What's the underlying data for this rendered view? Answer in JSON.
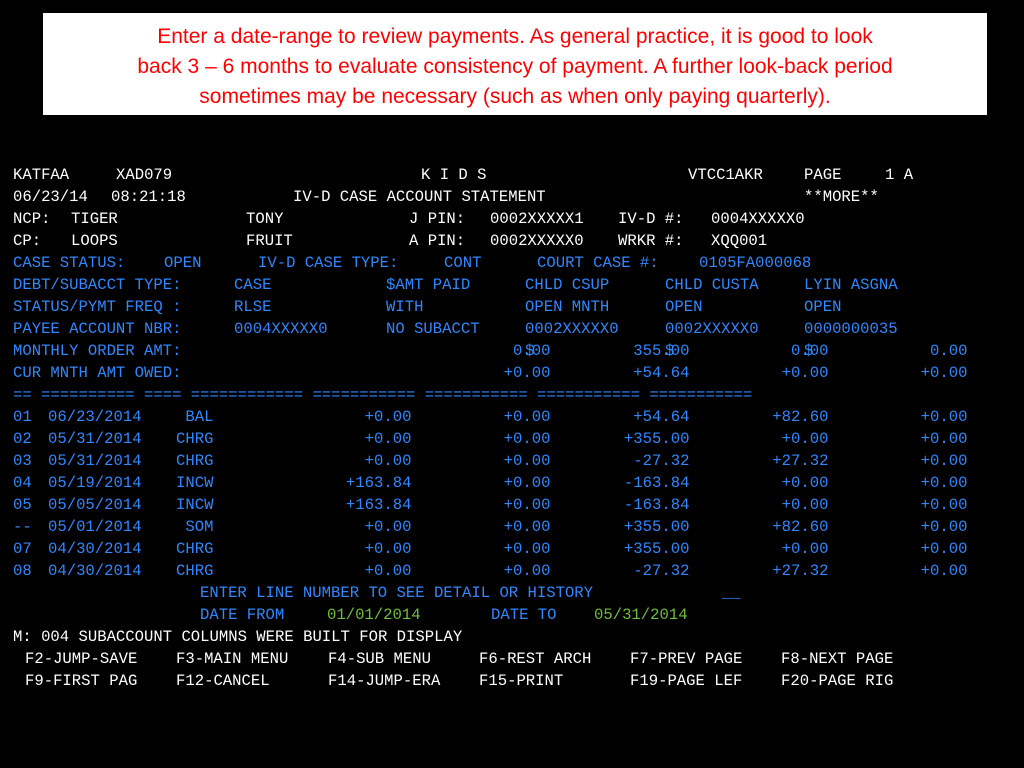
{
  "callout": {
    "lines": [
      "Enter a date-range to review payments.  As general practice, it is good to look",
      "back 3 – 6 months to evaluate consistency of payment. A further look-back period",
      "sometimes may be necessary (such as when only paying quarterly)."
    ]
  },
  "header": {
    "user": "KATFAA",
    "program": "XAD079",
    "system": "K I D S",
    "terminal": "VTCC1AKR",
    "page_label": "PAGE",
    "page_number": "1 A",
    "date": "06/23/14",
    "time": "08:21:18",
    "screen_title": "IV-D CASE ACCOUNT STATEMENT",
    "more": "**MORE**"
  },
  "ncp": {
    "label": "NCP:",
    "last": "TIGER",
    "first": "TONY",
    "pin_label": "J PIN:",
    "pin": "0002XXXXX1",
    "ivd_label": "IV-D #:",
    "ivd": "0004XXXXX0"
  },
  "cp": {
    "label": "CP:",
    "last": "LOOPS",
    "first": "FRUIT",
    "pin_label": "A PIN:",
    "pin": "0002XXXXX0",
    "wrkr_label": "WRKR #:",
    "wrkr": "XQQ001"
  },
  "case_status": {
    "status_label": "CASE STATUS:",
    "status": "OPEN",
    "type_label": "IV-D CASE TYPE:",
    "type": "CONT",
    "court_label": "COURT CASE #:",
    "court": "0105FA000068"
  },
  "table": {
    "debt_label": "DEBT/SUBACCT TYPE:",
    "debt_types": [
      "CASE",
      "$AMT PAID",
      "CHLD CSUP",
      "CHLD CUSTA",
      "LYIN ASGNA"
    ],
    "status_label": "STATUS/PYMT FREQ :",
    "statuses": [
      "RLSE",
      "WITH",
      "OPEN MNTH",
      "OPEN",
      "OPEN"
    ],
    "payee_label": "PAYEE ACCOUNT NBR:",
    "payees": [
      "0004XXXXX0",
      "NO SUBACCT",
      "0002XXXXX0",
      "0002XXXXX0",
      "0000000035"
    ],
    "monthly_label": "MONTHLY ORDER AMT:",
    "monthly": [
      "0.00",
      "$",
      "355.00",
      "$",
      "0.00",
      "$",
      "0.00"
    ],
    "cur_label": "CUR MNTH AMT OWED:",
    "cur": [
      "+0.00",
      "+54.64",
      "+0.00",
      "+0.00"
    ],
    "divider": "== ========== ==== ============ =========== =========== =========== ===========",
    "rows": [
      {
        "line": "01",
        "date": "06/23/2014",
        "code": " BAL",
        "v1": "+0.00",
        "v2": "+0.00",
        "v3": "+54.64",
        "v4": "+82.60",
        "v5": "+0.00"
      },
      {
        "line": "02",
        "date": "05/31/2014",
        "code": "CHRG",
        "v1": "+0.00",
        "v2": "+0.00",
        "v3": "+355.00",
        "v4": "+0.00",
        "v5": "+0.00"
      },
      {
        "line": "03",
        "date": "05/31/2014",
        "code": "CHRG",
        "v1": "+0.00",
        "v2": "+0.00",
        "v3": "-27.32",
        "v4": "+27.32",
        "v5": "+0.00"
      },
      {
        "line": "04",
        "date": "05/19/2014",
        "code": "INCW",
        "v1": "+163.84",
        "v2": "+0.00",
        "v3": "-163.84",
        "v4": "+0.00",
        "v5": "+0.00"
      },
      {
        "line": "05",
        "date": "05/05/2014",
        "code": "INCW",
        "v1": "+163.84",
        "v2": "+0.00",
        "v3": "-163.84",
        "v4": "+0.00",
        "v5": "+0.00"
      },
      {
        "line": "--",
        "date": "05/01/2014",
        "code": " SOM",
        "v1": "+0.00",
        "v2": "+0.00",
        "v3": "+355.00",
        "v4": "+82.60",
        "v5": "+0.00"
      },
      {
        "line": "07",
        "date": "04/30/2014",
        "code": "CHRG",
        "v1": "+0.00",
        "v2": "+0.00",
        "v3": "+355.00",
        "v4": "+0.00",
        "v5": "+0.00"
      },
      {
        "line": "08",
        "date": "04/30/2014",
        "code": "CHRG",
        "v1": "+0.00",
        "v2": "+0.00",
        "v3": "-27.32",
        "v4": "+27.32",
        "v5": "+0.00"
      }
    ]
  },
  "prompt": {
    "enter_line": "ENTER LINE NUMBER TO SEE DETAIL OR HISTORY",
    "line_input": "__",
    "date_from_label": "DATE FROM",
    "date_from": "01/01/2014",
    "date_to_label": "DATE TO",
    "date_to": "05/31/2014"
  },
  "message": "M: 004 SUBACCOUNT COLUMNS WERE BUILT FOR DISPLAY",
  "fkeys": {
    "row1": [
      {
        "key": "F2",
        "label": "JUMP-SAVE"
      },
      {
        "key": "F3",
        "label": "MAIN MENU"
      },
      {
        "key": "F4",
        "label": "SUB MENU"
      },
      {
        "key": "F6",
        "label": "REST ARCH"
      },
      {
        "key": "F7",
        "label": "PREV PAGE"
      },
      {
        "key": "F8",
        "label": "NEXT PAGE"
      }
    ],
    "row2": [
      {
        "key": "F9",
        "label": "FIRST PAG"
      },
      {
        "key": "F12",
        "label": "CANCEL"
      },
      {
        "key": "F14",
        "label": "JUMP-ERA"
      },
      {
        "key": "F15",
        "label": "PRINT"
      },
      {
        "key": "F19",
        "label": "PAGE LEF"
      },
      {
        "key": "F20",
        "label": "PAGE RIG"
      }
    ]
  },
  "colors": {
    "terminal_bg": "#000000",
    "text_white": "#ffffff",
    "text_cyan": "#2f88ff",
    "text_green": "#6fbf3a",
    "callout_red": "#ff0000"
  }
}
